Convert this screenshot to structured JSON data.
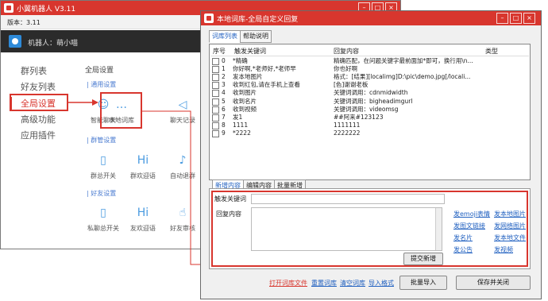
{
  "main_window": {
    "title": "小翼机器人 V3.11",
    "version": "版本：3.11",
    "robot": "机器人：萌小喵"
  },
  "nav": [
    "群列表",
    "好友列表",
    "全局设置",
    "高级功能",
    "应用插件"
  ],
  "global": {
    "heading": "全局设置",
    "sections": [
      "| 通用设置",
      "| 群管设置",
      "| 好友设置"
    ],
    "general": [
      {
        "label": "智能聊天",
        "icon": "☺"
      },
      {
        "label": "本地词库",
        "icon": "…"
      },
      {
        "label": "聊天记录",
        "icon": "◁"
      }
    ],
    "group": [
      {
        "label": "群总开关",
        "icon": "▯"
      },
      {
        "label": "群欢迎语",
        "icon": "Hi"
      },
      {
        "label": "自动退群",
        "icon": "♪"
      }
    ],
    "friend": [
      {
        "label": "私聊总开关",
        "icon": "▯"
      },
      {
        "label": "友欢迎语",
        "icon": "Hi"
      },
      {
        "label": "好友审核",
        "icon": "☝"
      }
    ]
  },
  "dialog": {
    "title": "本地词库-全局自定义回复",
    "tabs": [
      "词库列表",
      "帮助说明"
    ],
    "columns": [
      "序号",
      "触发关键词",
      "回复内容",
      "类型"
    ],
    "rows": [
      {
        "no": "0",
        "kw": "*精确",
        "reply": "精确匹配，在问题关键字最前面加*即可，换行用\\n..."
      },
      {
        "no": "1",
        "kw": "你好啊,*老师好,*老师早",
        "reply": "你也好啊"
      },
      {
        "no": "2",
        "kw": "发本地图片",
        "reply": "格式：[结果][localimg]D:\\pic\\demo.jpg[/locali..."
      },
      {
        "no": "3",
        "kw": "收到红包,请在手机上查看",
        "reply": "[色]谢谢老板"
      },
      {
        "no": "4",
        "kw": "收到图片",
        "reply": "关键词调用：cdnmidwidth"
      },
      {
        "no": "5",
        "kw": "收到名片",
        "reply": "关键词调用：bigheadimgurl"
      },
      {
        "no": "6",
        "kw": "收到视频",
        "reply": "关键词调用：videomsg"
      },
      {
        "no": "7",
        "kw": "发1",
        "reply": "##阿来#123123"
      },
      {
        "no": "8",
        "kw": "1111",
        "reply": "1111111"
      },
      {
        "no": "9",
        "kw": "*2222",
        "reply": "2222222"
      }
    ],
    "edit_tabs": [
      "新增内容",
      "编辑内容",
      "批量新增"
    ],
    "kw_label": "触发关键词",
    "reply_label": "回复内容",
    "submit": "提交新增",
    "insert_links": [
      "发emoji表情",
      "发本地图片",
      "发图文链接",
      "发网络图片",
      "发名片",
      "发本地文件",
      "发公告",
      "发视频"
    ],
    "bottom_links": [
      "打开词库文件",
      "重置词库",
      "清空词库",
      "导入格式"
    ],
    "bulk_import": "批量导入",
    "save_close": "保存并关闭"
  },
  "colors": {
    "accent": "#d8362e",
    "link": "#2060c0",
    "section": "#4a7bd0"
  }
}
